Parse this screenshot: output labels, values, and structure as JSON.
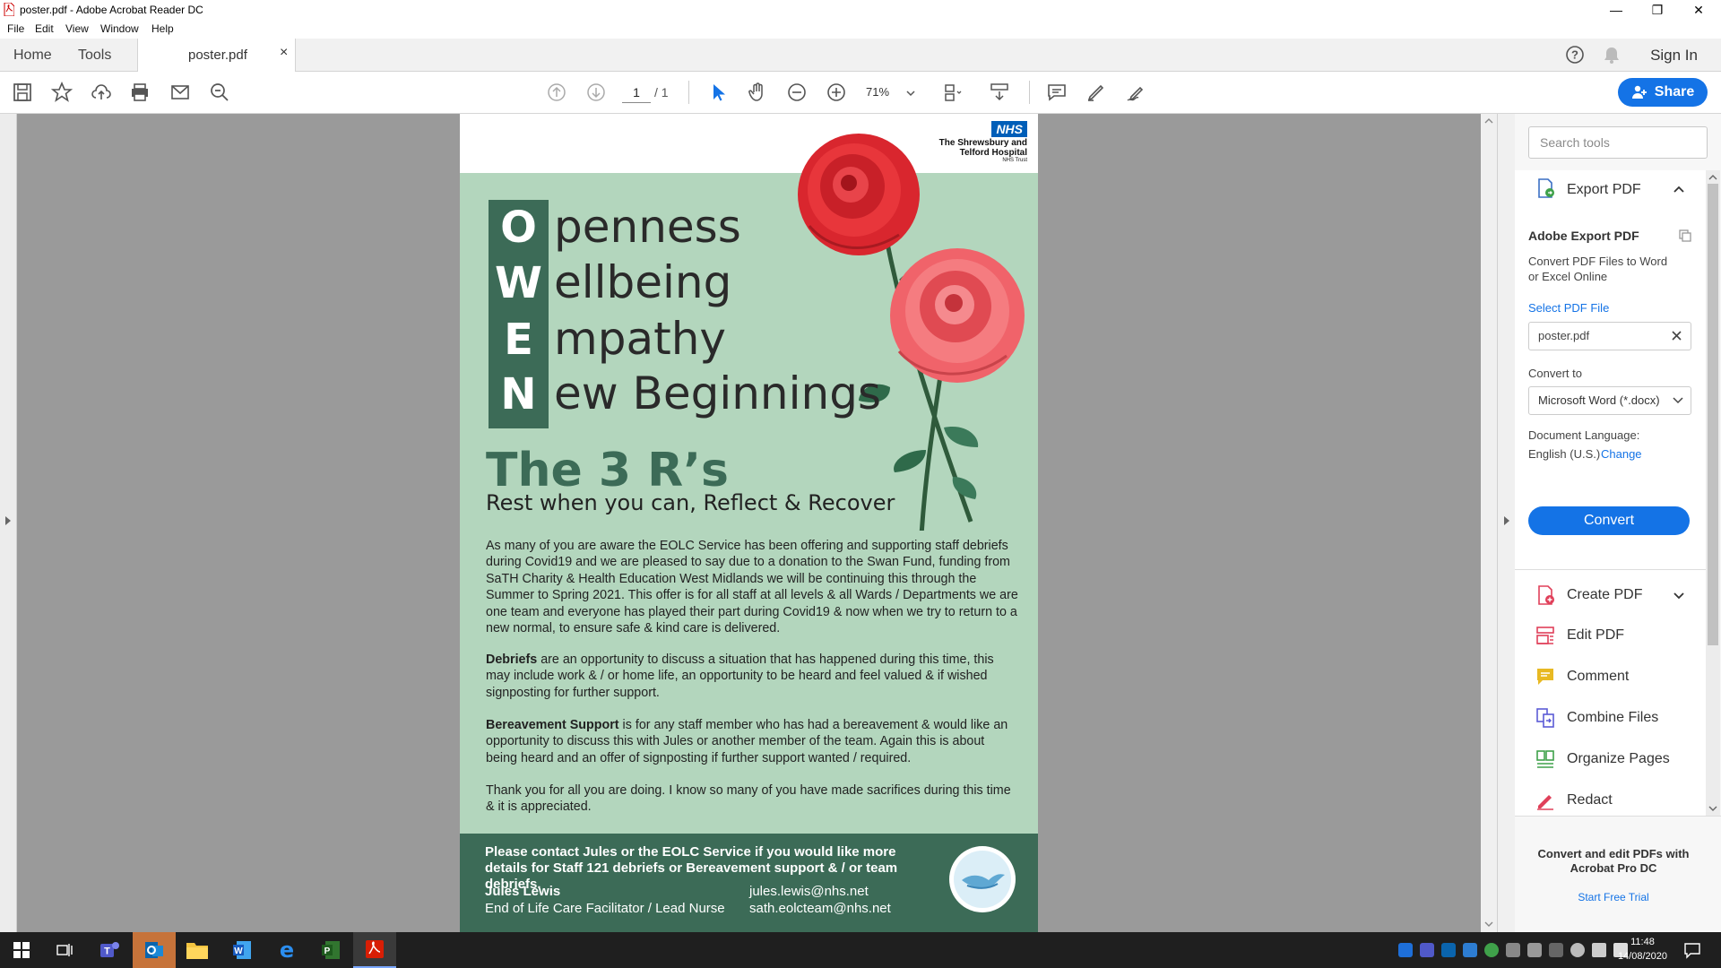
{
  "window": {
    "title": "poster.pdf - Adobe Acrobat Reader DC"
  },
  "menu": [
    "File",
    "Edit",
    "View",
    "Window",
    "Help"
  ],
  "tabs": {
    "home": "Home",
    "tools": "Tools",
    "document": "poster.pdf",
    "close": "×"
  },
  "header": {
    "sign_in": "Sign In",
    "share": "Share"
  },
  "toolbar": {
    "page_current": "1",
    "page_total": "/ 1",
    "zoom": "71%"
  },
  "poster": {
    "nhs_badge": "NHS",
    "trust_line1": "The Shrewsbury and",
    "trust_line2": "Telford Hospital",
    "trust_line3": "NHS Trust",
    "owen": [
      {
        "letter": "O",
        "rest": "penness"
      },
      {
        "letter": "W",
        "rest": "ellbeing"
      },
      {
        "letter": "E",
        "rest": "mpathy"
      },
      {
        "letter": "N",
        "rest": "ew Beginnings"
      }
    ],
    "three_rs": "The 3 R’s",
    "rest_line": "Rest when you can, Reflect & Recover",
    "para1": "As many of you are aware the EOLC Service has been offering and supporting staff debriefs during Covid19 and we are pleased to say due to a donation to the Swan Fund, funding from SaTH Charity & Health Education West Midlands we will be continuing this through the Summer to Spring 2021. This offer is for all staff at all levels & all Wards / Departments we are one team and everyone has played their part during Covid19 & now when we try to return to a new normal, to ensure safe & kind care is delivered.",
    "para2_bold": "Debriefs",
    "para2": " are an opportunity to discuss a situation that has happened during this time, this may include work & / or home life, an opportunity to be heard and feel valued & if wished signposting for further support.",
    "para3_bold": "Bereavement Support",
    "para3": " is for any staff member who has had a bereavement & would like an opportunity to discuss this with Jules or another member of the team. Again this is about being heard and an offer of signposting if further support wanted  / required.",
    "para4": "Thank you for all you are doing. I know so many of you have made sacrifices during this time & it is appreciated.",
    "footer_line": "Please contact Jules or the EOLC Service if you would like more details for Staff 121 debriefs or Bereavement support & / or team debriefs.",
    "footer_name": "Jules Lewis",
    "footer_role": "End of Life Care Facilitator / Lead Nurse",
    "footer_email1": "jules.lewis@nhs.net",
    "footer_email2": "sath.eolcteam@nhs.net"
  },
  "right_panel": {
    "search_placeholder": "Search tools",
    "export_title": "Export PDF",
    "adobe_export": "Adobe Export PDF",
    "export_desc": "Convert PDF Files to Word or Excel Online",
    "select_file": "Select PDF File",
    "selected_file": "poster.pdf",
    "convert_to_label": "Convert to",
    "convert_to_value": "Microsoft Word (*.docx)",
    "doc_lang_label": "Document Language:",
    "doc_lang_value": "English (U.S.)",
    "change": "Change",
    "convert_btn": "Convert",
    "tools": [
      {
        "name": "Create PDF",
        "icon": "create-pdf-icon",
        "color": "#e0405a"
      },
      {
        "name": "Edit PDF",
        "icon": "edit-pdf-icon",
        "color": "#e0405a"
      },
      {
        "name": "Comment",
        "icon": "comment-icon",
        "color": "#e8b923"
      },
      {
        "name": "Combine Files",
        "icon": "combine-files-icon",
        "color": "#5b5bd6"
      },
      {
        "name": "Organize Pages",
        "icon": "organize-pages-icon",
        "color": "#3fa14a"
      },
      {
        "name": "Redact",
        "icon": "redact-icon",
        "color": "#e0405a"
      }
    ],
    "promo": "Convert and edit PDFs with Acrobat Pro DC",
    "trial": "Start Free Trial"
  },
  "taskbar": {
    "time": "11:48",
    "date": "14/08/2020"
  },
  "colors": {
    "accent": "#1473e6",
    "poster_green": "#b3d6bd",
    "poster_dark_green": "#3c6b57",
    "nhs_blue": "#005eb8"
  }
}
